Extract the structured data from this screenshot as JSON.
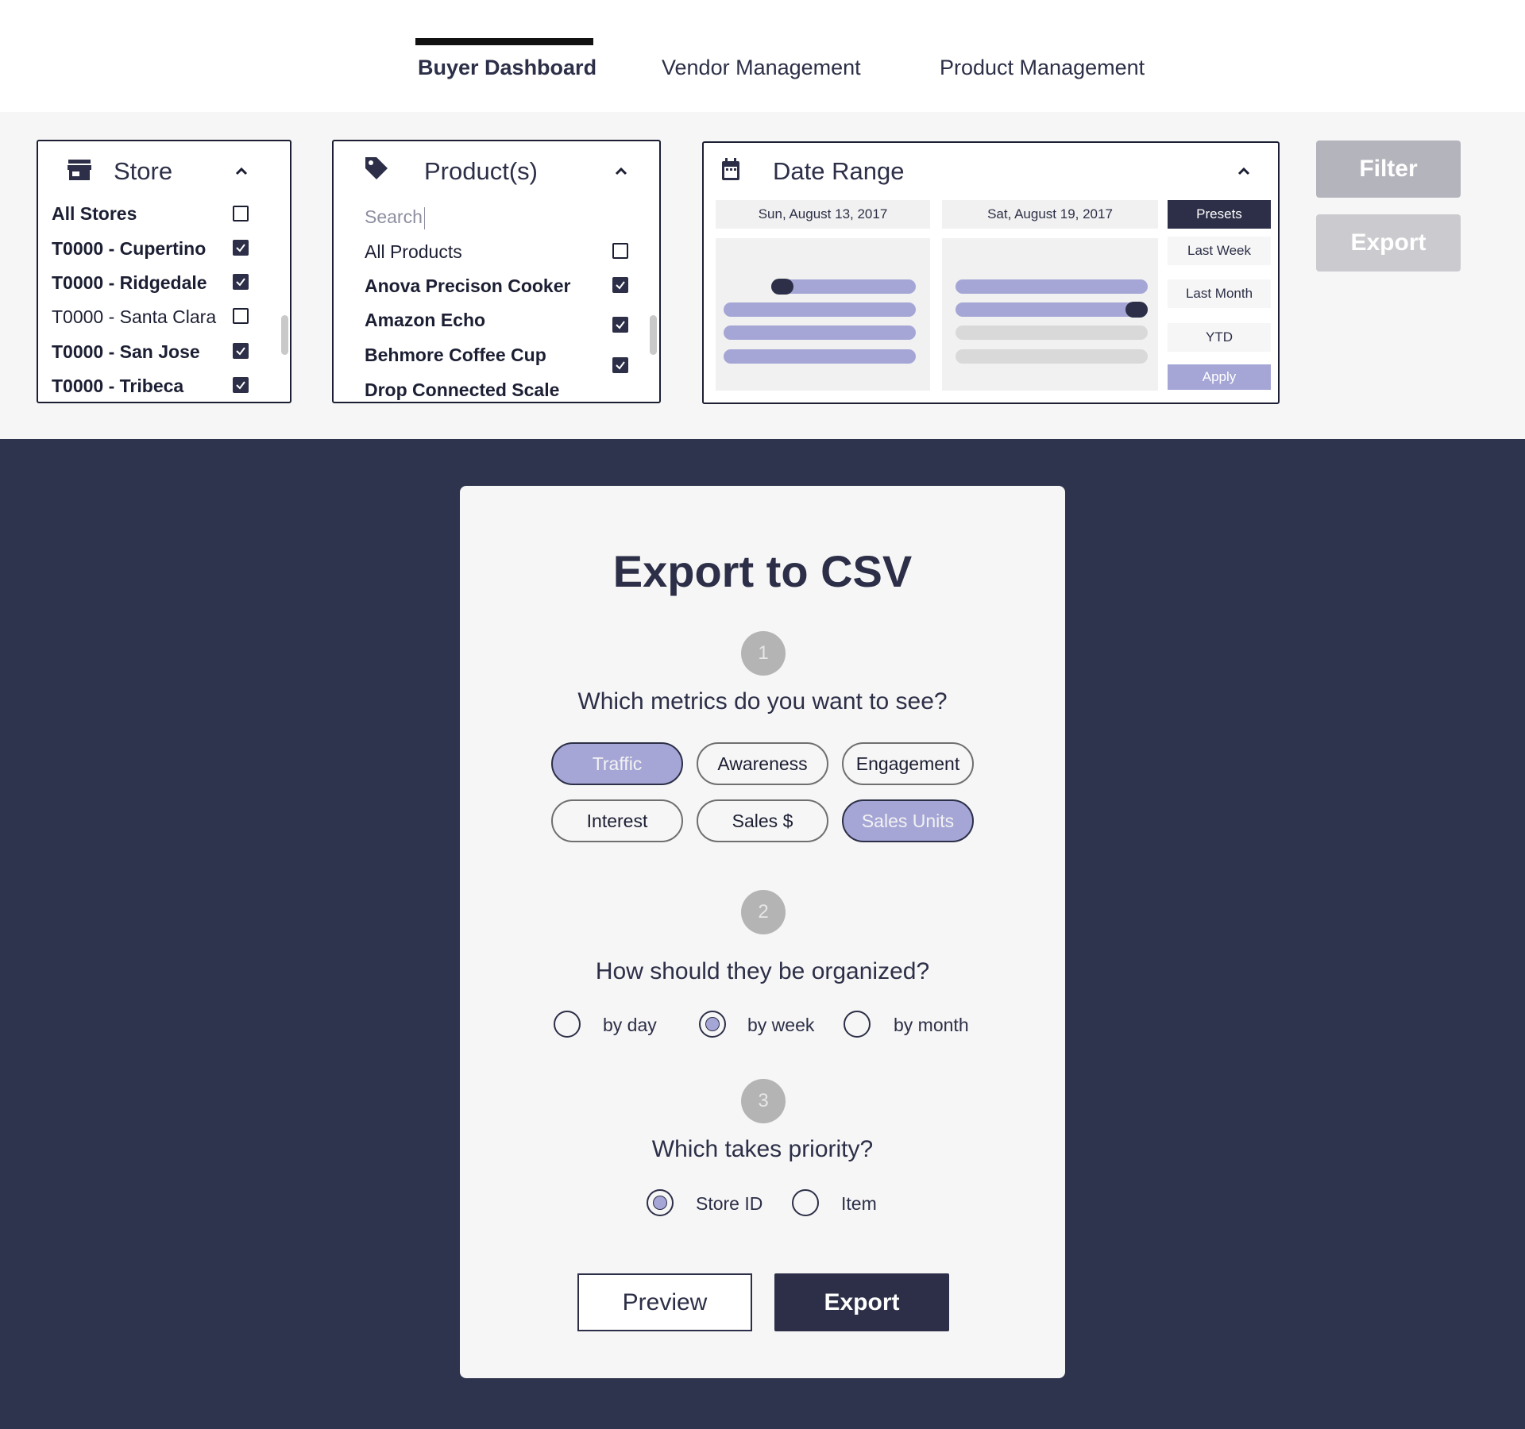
{
  "nav": {
    "tabs": [
      {
        "label": "Buyer Dashboard",
        "active": true
      },
      {
        "label": "Vendor Management",
        "active": false
      },
      {
        "label": "Product Management",
        "active": false
      }
    ]
  },
  "filters": {
    "store": {
      "title": "Store",
      "icon": "store-icon",
      "items": [
        {
          "label": "All Stores",
          "checked": false
        },
        {
          "label": "T0000 - Cupertino",
          "checked": true
        },
        {
          "label": "T0000 - Ridgedale",
          "checked": true
        },
        {
          "label": "T0000 - Santa Clara",
          "checked": false
        },
        {
          "label": "T0000 - San Jose",
          "checked": true
        },
        {
          "label": "T0000 - Tribeca",
          "checked": true
        }
      ]
    },
    "products": {
      "title": "Product(s)",
      "icon": "tag-icon",
      "search_placeholder": "Search",
      "items": [
        {
          "label": "All Products",
          "checked": false
        },
        {
          "label": "Anova Precison Cooker",
          "checked": true
        },
        {
          "label": "Amazon Echo",
          "checked": true
        },
        {
          "label": "Behmore Coffee Cup",
          "checked": true
        },
        {
          "label": "Drop Connected Scale",
          "checked": false
        }
      ]
    },
    "date_range": {
      "title": "Date Range",
      "icon": "calendar-icon",
      "start_date": "Sun, August 13, 2017",
      "end_date": "Sat, August 19, 2017",
      "presets_label": "Presets",
      "presets": [
        "Last Week",
        "Last Month",
        "YTD"
      ],
      "apply_label": "Apply"
    },
    "filter_button": "Filter",
    "export_button": "Export"
  },
  "modal": {
    "title": "Export to CSV",
    "steps": [
      {
        "number": "1",
        "question": "Which metrics do you want to see?",
        "options": [
          {
            "label": "Traffic",
            "selected": true
          },
          {
            "label": "Awareness",
            "selected": false
          },
          {
            "label": "Engagement",
            "selected": false
          },
          {
            "label": "Interest",
            "selected": false
          },
          {
            "label": "Sales $",
            "selected": false
          },
          {
            "label": "Sales Units",
            "selected": true
          }
        ]
      },
      {
        "number": "2",
        "question": "How should they be organized?",
        "options": [
          {
            "label": "by day",
            "selected": false
          },
          {
            "label": "by week",
            "selected": true
          },
          {
            "label": "by month",
            "selected": false
          }
        ]
      },
      {
        "number": "3",
        "question": "Which takes priority?",
        "options": [
          {
            "label": "Store ID",
            "selected": true
          },
          {
            "label": "Item",
            "selected": false
          }
        ]
      }
    ],
    "preview_button": "Preview",
    "export_button": "Export"
  },
  "colors": {
    "dark_navy": "#2f344e",
    "accent_lavender": "#a5a6d6",
    "disabled_gray": "#b4b4bd"
  }
}
